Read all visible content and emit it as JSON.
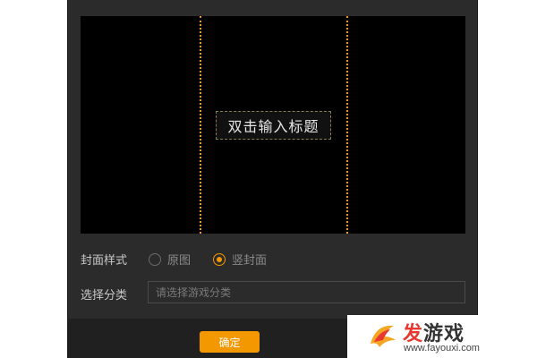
{
  "preview": {
    "title_placeholder": "双击输入标题"
  },
  "cover_style": {
    "label": "封面样式",
    "options": [
      {
        "label": "原图",
        "selected": false
      },
      {
        "label": "竖封面",
        "selected": true
      }
    ]
  },
  "category": {
    "label": "选择分类",
    "placeholder": "请选择游戏分类"
  },
  "footer": {
    "confirm_label": "确定"
  },
  "watermark": {
    "brand_part1": "发",
    "brand_part2": "游戏",
    "url": "www.fayouxi.com"
  },
  "colors": {
    "accent": "#f39800",
    "panel_bg": "#2b2b2b",
    "preview_bg": "#000000"
  }
}
